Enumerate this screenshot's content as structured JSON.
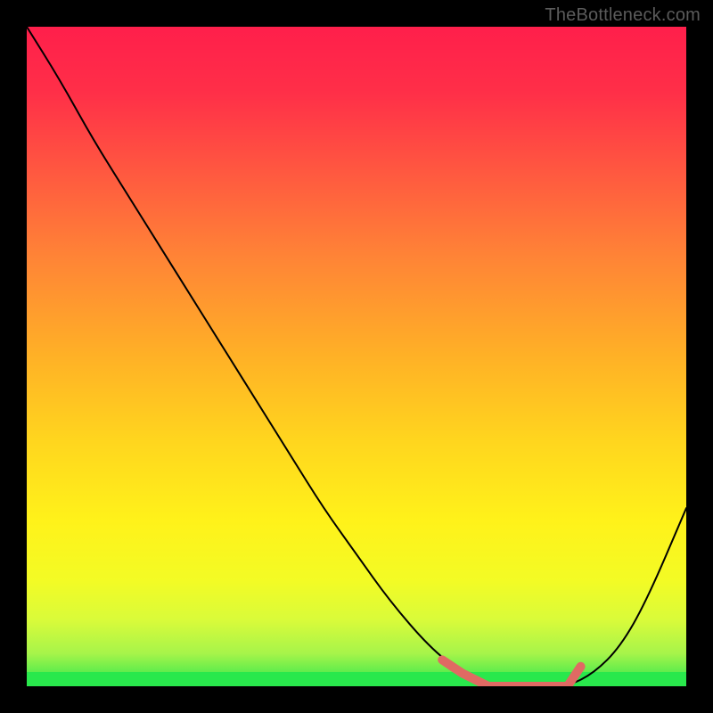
{
  "watermark": "TheBottleneck.com",
  "colors": {
    "curve": "#000000",
    "highlight": "#e06a63",
    "frame": "#000000",
    "gradient_top": "#ff1f4b",
    "gradient_bottom": "#29e84c"
  },
  "chart_data": {
    "type": "line",
    "title": "",
    "xlabel": "",
    "ylabel": "",
    "xlim": [
      0,
      100
    ],
    "ylim": [
      0,
      100
    ],
    "series": [
      {
        "name": "bottleneck-curve",
        "x": [
          0,
          5,
          10,
          15,
          20,
          25,
          30,
          35,
          40,
          45,
          50,
          55,
          61,
          66,
          70,
          74,
          78,
          82,
          86,
          90,
          94,
          100
        ],
        "y": [
          100,
          92,
          83,
          75,
          67,
          59,
          51,
          43,
          35,
          27,
          20,
          13,
          6,
          2,
          0,
          0,
          0,
          0,
          2,
          6,
          13,
          27
        ]
      }
    ],
    "highlight_range_x": [
      63,
      84
    ],
    "highlight_points": {
      "x": [
        63,
        66,
        70,
        74,
        78,
        82,
        84
      ],
      "y": [
        4,
        2,
        0,
        0,
        0,
        0,
        3
      ]
    },
    "annotations": []
  }
}
